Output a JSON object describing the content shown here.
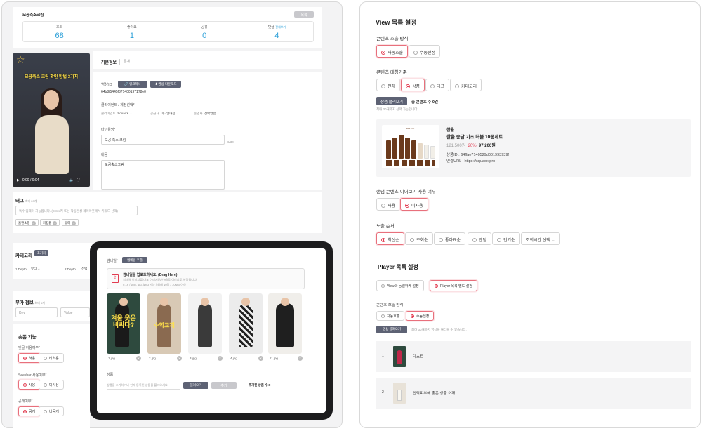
{
  "left": {
    "stats_title": "모공축소크림",
    "top_button": "목록",
    "stats": [
      {
        "label": "조회",
        "value": "68",
        "extra": ""
      },
      {
        "label": "좋아요",
        "value": "1",
        "extra": ""
      },
      {
        "label": "공유",
        "value": "0",
        "extra": ""
      },
      {
        "label": "댓글",
        "value": "4",
        "extra": "전체보기"
      }
    ],
    "video": {
      "caption": "모공축소 크림 확인 방법 3가지",
      "time": "0:00 / 0:04"
    },
    "tabs": {
      "basic": "기본정보",
      "detail": "통계"
    },
    "video_id_label": "영상ID",
    "video_id_value": "64b8f5445f371400197178e0",
    "copy_link_btn": "링크복사",
    "download_btn": "영상 다운로드",
    "client_label": "클라이언트 / 계정선택*",
    "client_fields": [
      {
        "label": "클라이언트",
        "value": "SquadX"
      },
      {
        "label": "공급사",
        "value": "미니멀대장"
      },
      {
        "label": "운영자",
        "value": "선택안함"
      }
    ],
    "title_label": "타이틀명*",
    "title_value": "모공 축소 크림",
    "title_count": "6/30",
    "content_label": "내용",
    "content_value": "모공축소크림",
    "tag_section": "태그",
    "tag_hint": "최대 20개",
    "tag_placeholder": "특수 입력이 가능합니다. (Enter키 또는 작동완성 레이아웃에서 키워드 선택)",
    "tags": [
      "홈캔쇼핑",
      "화장품",
      "뷰티"
    ],
    "category_section": "카테고리",
    "category_button": "초기화",
    "depth1_label": "1 Depth",
    "depth1_value": "뷰티",
    "depth2_label": "2 Depth",
    "depth2_value": "선택",
    "extra_section": "부가 정보",
    "extra_hint": "최대 5개",
    "key_placeholder": "Key",
    "value_placeholder": "Value",
    "shop_section": "숏폼 기능",
    "comment_label": "댓글 허용여부*",
    "seekbar_label": "Seekbar 사용여부*",
    "public_label": "공개여부*",
    "opt_allow": "허용",
    "opt_deny": "비허용",
    "opt_use": "사용",
    "opt_nouse": "미사용",
    "opt_public": "공개",
    "opt_private": "비공개"
  },
  "tablet": {
    "thumb_label": "썸네일*",
    "thumb_tab": "썸네일 추출",
    "upload_title": "썸네일을 업로드하세요. (Drag Here)",
    "upload_desc": "썸네일 이미지를 대표 이미지(첫번째)로 이미지로 설정됩니다.",
    "upload_spec": "9:16 / png, jpg, jpeg 가능 / 최대 10장 / 10MB 이하",
    "thumb_texts": [
      "겨울 옷은 비싸다?",
      "수학교재"
    ],
    "files": [
      "1.jpg",
      "2.jpg",
      "3.jpg",
      "4.jpg",
      "11.jpg"
    ],
    "product_label": "상품",
    "product_placeholder": "상품을 추가하거나 현재 등록된 상품을 불러오세요",
    "load_btn": "불러오기",
    "add_btn": "추가",
    "added_count": "추가된 상품 수:0"
  },
  "right": {
    "title": "View 목록 설정",
    "call_method": "콘텐츠 호출 방식",
    "opt_auto": "자동호출",
    "opt_manual": "수동선정",
    "match_std": "콘텐츠 매칭기준",
    "match_opts": [
      "전체",
      "상품",
      "태그",
      "카테고리"
    ],
    "load_products_btn": "상품 불러오기",
    "total_content": "총 콘텐츠 수 0건",
    "max_hint": "최대 30개까지 선택 가능합니다.",
    "product": {
      "brand": "한율",
      "name": "한율 송담 기초 더블 10종세트",
      "price_orig": "121,500원",
      "discount": "20%",
      "price": "97,200원",
      "product_id": "상품ID : 64ffae7140529d001993939f",
      "url": "연결URL : https://squadx.pro",
      "img_label": "HANYUL"
    },
    "random_label": "랜덤 콘텐츠 이어보기 사용 여부",
    "opt_use": "사용",
    "opt_nouse": "미사용",
    "order_label": "노출 순서",
    "order_opts": [
      "최신순",
      "조회순",
      "좋아요순",
      "랜덤",
      "인기순"
    ],
    "order_time": "조회시간 선택",
    "player_title": "Player 목록 설정",
    "player_opts": [
      "View와 동일하게 설정",
      "Player 목록 별도 설정"
    ],
    "player_call": "콘텐츠 호출 방식",
    "player_load_btn": "영상 불러오기",
    "player_hint": "최대 30개까지 영상을 불러올 수 있습니다.",
    "rows": [
      {
        "num": "1",
        "title": "테스트"
      },
      {
        "num": "2",
        "title": "안락피부에 좋은 상품 소개"
      }
    ]
  }
}
